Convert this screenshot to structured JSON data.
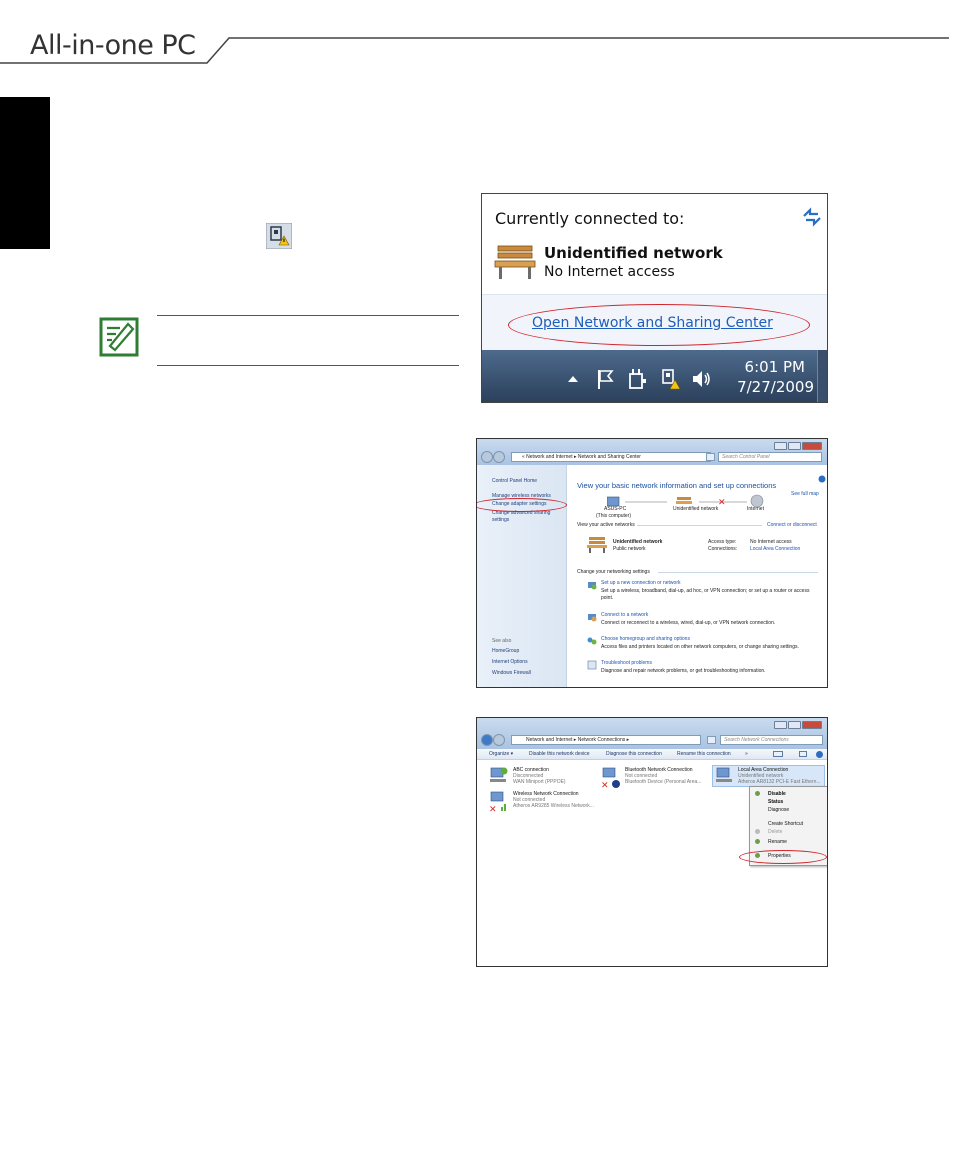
{
  "header": {
    "title": "All-in-one PC"
  },
  "screenshot1": {
    "title": "Currently connected to:",
    "network_name": "Unidentified network",
    "network_status": "No Internet access",
    "link": "Open Network and Sharing Center",
    "time": "6:01 PM",
    "date": "7/27/2009"
  },
  "screenshot2": {
    "breadcrumb": "«  Network and Internet  ▸  Network and Sharing Center",
    "search_placeholder": "Search Control Panel",
    "sidebar": {
      "home": "Control Panel Home",
      "manage_wireless": "Manage wireless networks",
      "change_adapter": "Change adapter settings",
      "change_sharing_1": "Change advanced sharing",
      "change_sharing_2": "settings",
      "see_also": "See also",
      "homegroup": "HomeGroup",
      "internet_options": "Internet Options",
      "firewall": "Windows Firewall"
    },
    "heading": "View your basic network information and set up connections",
    "see_full_map": "See full map",
    "pc_name": "ASUS-PC",
    "pc_note": "(This computer)",
    "map_network": "Unidentified network",
    "map_internet": "Internet",
    "active_networks": "View your active networks",
    "connect_disconnect": "Connect or disconnect",
    "net_name": "Unidentified network",
    "net_type": "Public network",
    "access_type_label": "Access type:",
    "access_type_value": "No Internet access",
    "connections_label": "Connections:",
    "connections_value": "Local Area Connection",
    "change_settings": "Change your networking settings",
    "task1_title": "Set up a new connection or network",
    "task1_desc_1": "Set up a wireless, broadband, dial-up, ad hoc, or VPN connection; or set up a router or access",
    "task1_desc_2": "point.",
    "task2_title": "Connect to a network",
    "task2_desc": "Connect or reconnect to a wireless, wired, dial-up, or VPN network connection.",
    "task3_title": "Choose homegroup and sharing options",
    "task3_desc": "Access files and printers located on other network computers, or change sharing settings.",
    "task4_title": "Troubleshoot problems",
    "task4_desc": "Diagnose and repair network problems, or get troubleshooting information."
  },
  "screenshot3": {
    "breadcrumb": "Network and Internet  ▸  Network Connections  ▸",
    "search_placeholder": "Search Network Connections",
    "toolbar": {
      "organize": "Organize ▾",
      "disable": "Disable this network device",
      "diagnose": "Diagnose this connection",
      "rename": "Rename this connection",
      "more": "»"
    },
    "items": [
      {
        "name": "ABC connection",
        "status": "Disconnected",
        "device": "WAN Miniport (PPPOE)"
      },
      {
        "name": "Bluetooth Network Connection",
        "status": "Not connected",
        "device": "Bluetooth Device (Personal Area..."
      },
      {
        "name": "Local Area Connection",
        "status": "Unidentified network",
        "device": "Atheros AR8132 PCI-E Fast Ethern..."
      },
      {
        "name": "Wireless Network Connection",
        "status": "Not connected",
        "device": "Atheros AR9285 Wireless Network..."
      }
    ],
    "menu": {
      "disable": "Disable",
      "status": "Status",
      "diagnose": "Diagnose",
      "create_shortcut": "Create Shortcut",
      "delete": "Delete",
      "rename": "Rename",
      "properties": "Properties"
    }
  },
  "colors": {
    "accent_red": "#d0262b",
    "link_blue": "#1e5eb8",
    "note_green": "#2e7d32"
  }
}
